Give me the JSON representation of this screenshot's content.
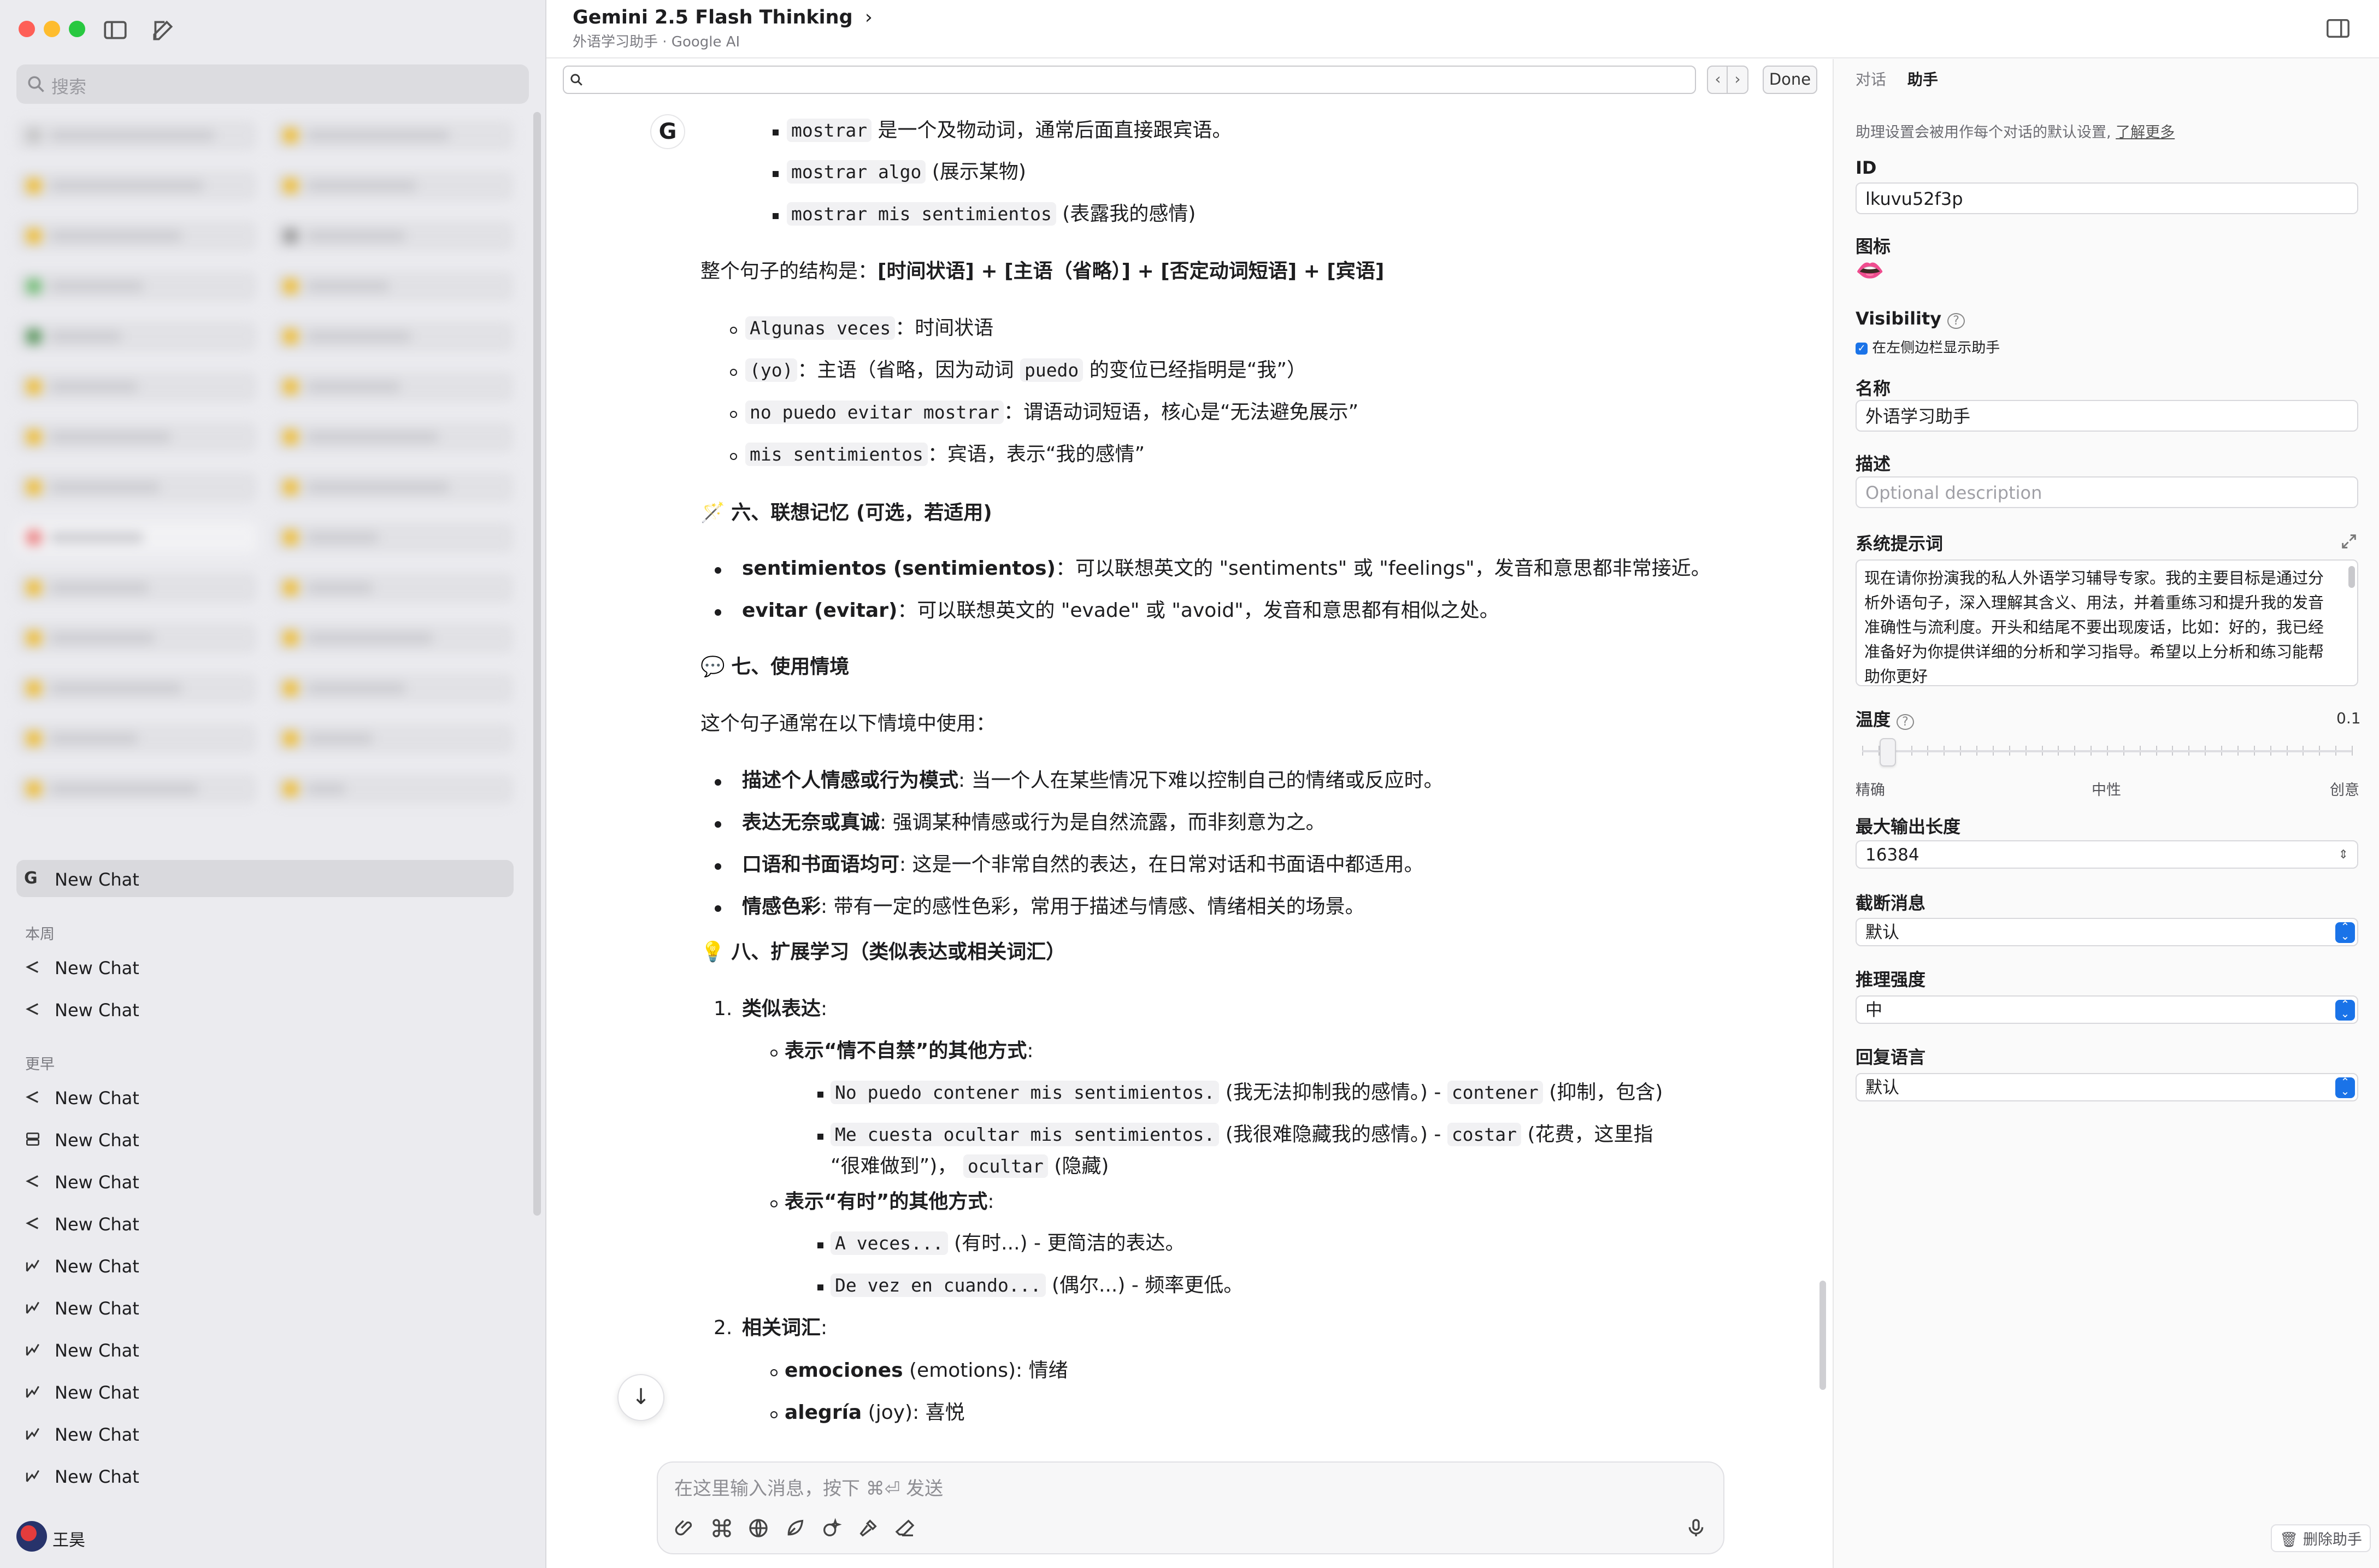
{
  "app": {
    "title": "Gemini 2.5 Flash Thinking",
    "subtitle": "外语学习助手  ·  Google AI"
  },
  "sidebar": {
    "search_placeholder": "搜索",
    "pinned_item": "New Chat",
    "section_week": "本周",
    "week_items": [
      "New Chat",
      "New Chat"
    ],
    "section_earlier": "更早",
    "earlier_items": [
      "New Chat",
      "New Chat",
      "New Chat",
      "New Chat",
      "New Chat",
      "New Chat",
      "New Chat",
      "New Chat",
      "New Chat",
      "New Chat"
    ],
    "user_name": "王昊"
  },
  "findbar": {
    "done": "Done"
  },
  "chat": {
    "l1": "是一个及物动词，通常后面直接跟宾语。",
    "l2": "(展示某物)",
    "l3": "(表露我的感情)",
    "struct": "整个句子的结构是：",
    "struct_b": "[时间状语] + [主语（省略）] + [否定动词短语] + [宾语]",
    "s1": "：时间状语",
    "s2a": "：主语（省略，因为动词",
    "s2b": "的变位已经指明是“我”）",
    "s3": "：谓语动词短语，核心是“无法避免展示”",
    "s4": "：宾语，表示“我的感情”",
    "h6": "六、联想记忆 (可选，若适用)",
    "m1b": "sentimientos (sentimientos)",
    "m1": "：可以联想英文的 \"sentiments\" 或 \"feelings\"，发音和意思都非常接近。",
    "m2b": "evitar (evitar)",
    "m2": "：可以联想英文的 \"evade\" 或 \"avoid\"，发音和意思都有相似之处。",
    "h7": "七、使用情境",
    "ctx": "这个句子通常在以下情境中使用：",
    "c1b": "描述个人情感或行为模式",
    "c1": ": 当一个人在某些情况下难以控制自己的情绪或反应时。",
    "c2b": "表达无奈或真诚",
    "c2": ": 强调某种情感或行为是自然流露，而非刻意为之。",
    "c3b": "口语和书面语均可",
    "c3": ": 这是一个非常自然的表达，在日常对话和书面语中都适用。",
    "c4b": "情感色彩",
    "c4": ": 带有一定的感性色彩，常用于描述与情感、情绪相关的场景。",
    "h8": "八、扩展学习（类似表达或相关词汇）",
    "n1": "类似表达",
    "n1c": ":",
    "e1b": "表示“情不自禁”的其他方式",
    "e1c": ":",
    "x1": "(我无法抑制我的感情。) -",
    "x1b": "(抑制，包含)",
    "x2": "(我很难隐藏我的感情。) -",
    "x2b": "(花费，这里指",
    "x2c": "“很难做到”)，",
    "x2d": "(隐藏)",
    "e2b": "表示“有时”的其他方式",
    "e2c": ":",
    "y1": "(有时...) - 更简洁的表达。",
    "y2": "(偶尔...) - 频率更低。",
    "n2": "相关词汇",
    "n2c": ":",
    "w1b": "emociones",
    "w1": "(emotions): 情绪",
    "w2b": "alegría",
    "w2": "(joy): 喜悦",
    "code": {
      "mostrar": "mostrar",
      "mostrar_algo": "mostrar algo",
      "mostrar_mis": "mostrar mis sentimientos",
      "algunas": "Algunas veces",
      "yo": "(yo)",
      "puedo": "puedo",
      "no_puedo": "no puedo evitar mostrar",
      "mis_sent": "mis sentimientos",
      "contener_s": "No puedo contener mis sentimientos.",
      "contener": "contener",
      "cuesta_s": "Me cuesta ocultar mis sentimientos.",
      "costar": "costar",
      "ocultar": "ocultar",
      "aveces": "A veces...",
      "devez": "De vez en cuando..."
    }
  },
  "composer": {
    "placeholder": "在这里输入消息，按下 ⌘⏎ 发送"
  },
  "panel": {
    "tab_chat": "对话",
    "tab_assistant": "助手",
    "hint": "助理设置会被用作每个对话的默认设置, ",
    "hint_link": "了解更多",
    "id_label": "ID",
    "id_value": "lkuvu52f3p",
    "icon_label": "图标",
    "icon_emoji": "👄",
    "visibility_label": "Visibility",
    "visibility_check": "在左侧边栏显示助手",
    "name_label": "名称",
    "name_value": "外语学习助手",
    "desc_label": "描述",
    "desc_placeholder": "Optional description",
    "sys_label": "系统提示词",
    "sys_text": "现在请你扮演我的私人外语学习辅导专家。我的主要目标是通过分析外语句子，深入理解其含义、用法，并着重练习和提升我的发音准确性与流利度。开头和结尾不要出现废话，比如：好的，我已经准备好为你提供详细的分析和学习指导。希望以上分析和练习能帮助你更好",
    "temp_label": "温度",
    "temp_value": "0.1",
    "temp_fraction": 0.05,
    "slider_low": "精确",
    "slider_mid": "中性",
    "slider_high": "创意",
    "maxlen_label": "最大输出长度",
    "maxlen_value": "16384",
    "trunc_label": "截断消息",
    "trunc_value": "默认",
    "reason_label": "推理强度",
    "reason_value": "中",
    "lang_label": "回复语言",
    "lang_value": "默认",
    "delete_label": "删除助手"
  }
}
